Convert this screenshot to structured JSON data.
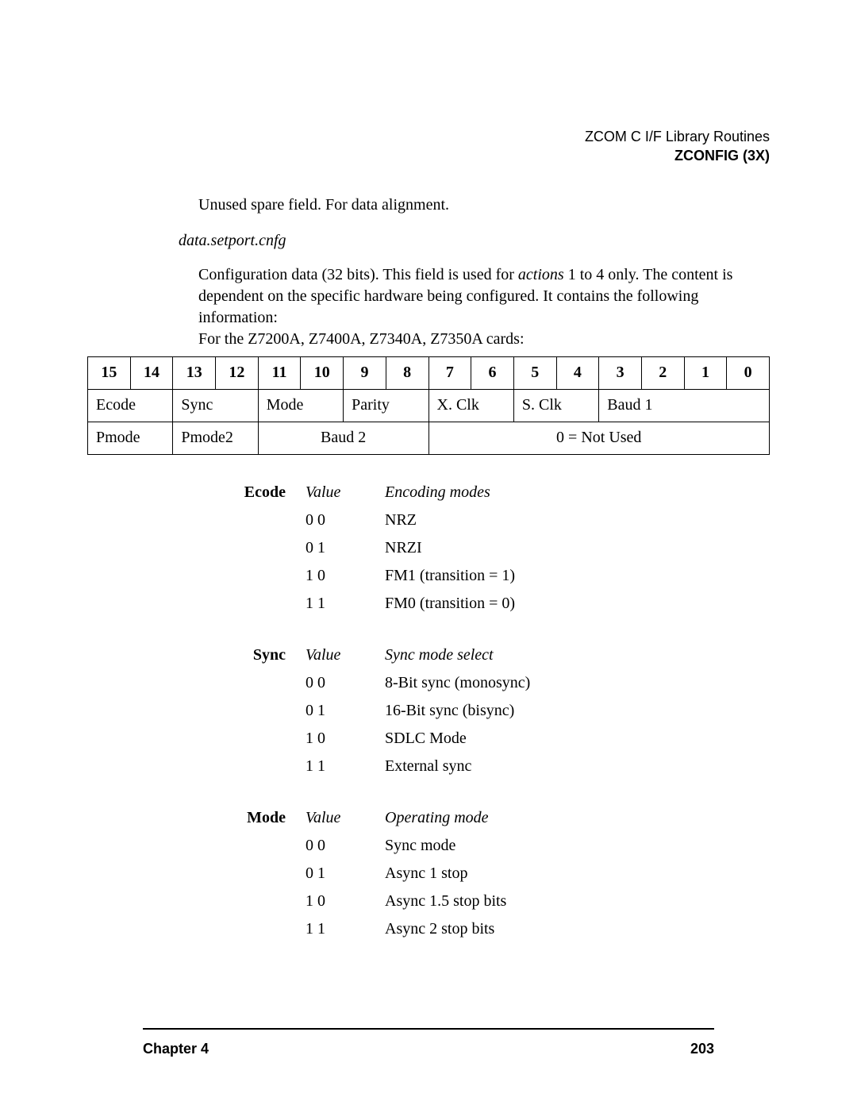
{
  "header": {
    "line1": "ZCOM C I/F Library Routines",
    "line2": "ZCONFIG (3X)"
  },
  "spare_line": "Unused spare field. For data alignment.",
  "setport_label": "data.setport.cnfg",
  "config_desc": {
    "l1": "Configuration data (32 bits). This field is used for ",
    "l1b": "actions",
    "l1c": " 1 to 4 only. The content is dependent on the specific hardware being configured. It contains the following information:",
    "l2": "For the Z7200A, Z7400A, Z7340A, Z7350A cards:"
  },
  "bit_table": {
    "bits": [
      "15",
      "14",
      "13",
      "12",
      "11",
      "10",
      "9",
      "8",
      "7",
      "6",
      "5",
      "4",
      "3",
      "2",
      "1",
      "0"
    ],
    "row1": [
      "Ecode",
      "Sync",
      "Mode",
      "Parity",
      "X. Clk",
      "S. Clk",
      "Baud 1"
    ],
    "row2": [
      "Pmode",
      "Pmode2",
      "Baud 2",
      "0 = Not Used"
    ]
  },
  "defs": [
    {
      "label": "Ecode",
      "heading": [
        "Value",
        "Encoding modes"
      ],
      "rows": [
        [
          "0 0",
          "NRZ"
        ],
        [
          "0 1",
          "NRZI"
        ],
        [
          "1 0",
          "FM1 (transition = 1)"
        ],
        [
          "1 1",
          "FM0 (transition = 0)"
        ]
      ]
    },
    {
      "label": "Sync",
      "heading": [
        "Value",
        "Sync mode select"
      ],
      "rows": [
        [
          "0 0",
          "8-Bit sync (monosync)"
        ],
        [
          "0 1",
          "16-Bit sync (bisync)"
        ],
        [
          "1 0",
          "SDLC Mode"
        ],
        [
          "1 1",
          "External sync"
        ]
      ]
    },
    {
      "label": "Mode",
      "heading": [
        "Value",
        "Operating mode"
      ],
      "rows": [
        [
          "0 0",
          "Sync mode"
        ],
        [
          "0 1",
          "Async 1 stop"
        ],
        [
          "1 0",
          "Async 1.5 stop bits"
        ],
        [
          "1 1",
          "Async 2 stop bits"
        ]
      ]
    }
  ],
  "footer": {
    "chapter": "Chapter 4",
    "page": "203"
  }
}
